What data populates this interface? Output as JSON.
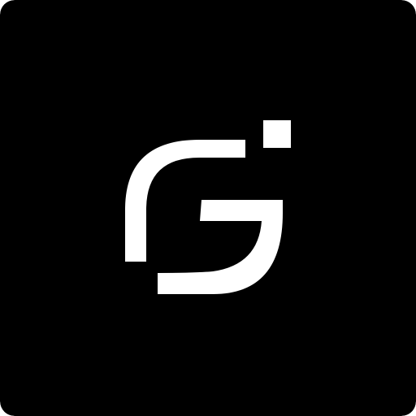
{
  "icon": {
    "name": "stylized-g-logo-icon",
    "background_color": "#000000",
    "foreground_color": "#ffffff"
  }
}
